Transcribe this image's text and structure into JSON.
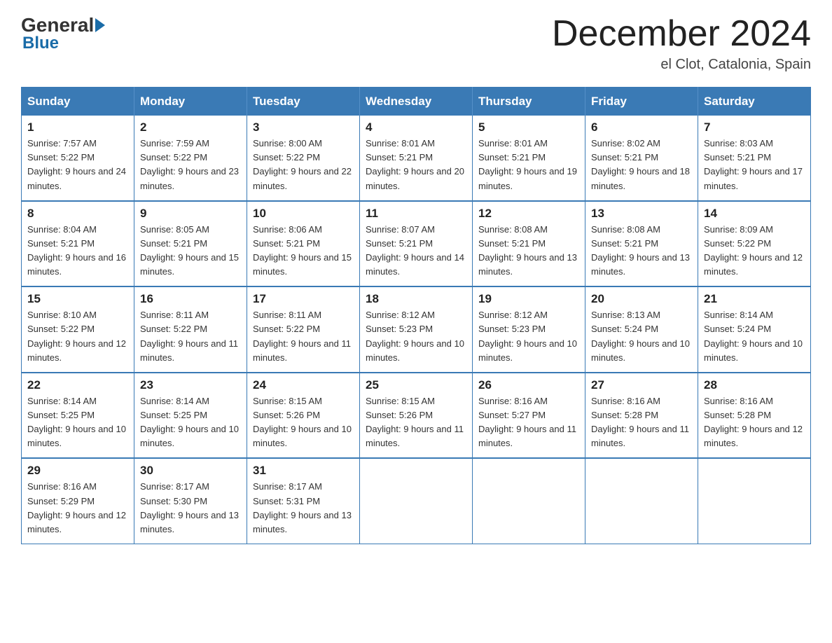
{
  "logo": {
    "general": "General",
    "blue": "Blue"
  },
  "header": {
    "month_title": "December 2024",
    "location": "el Clot, Catalonia, Spain"
  },
  "days_of_week": [
    "Sunday",
    "Monday",
    "Tuesday",
    "Wednesday",
    "Thursday",
    "Friday",
    "Saturday"
  ],
  "weeks": [
    [
      {
        "day": "1",
        "sunrise": "7:57 AM",
        "sunset": "5:22 PM",
        "daylight": "9 hours and 24 minutes."
      },
      {
        "day": "2",
        "sunrise": "7:59 AM",
        "sunset": "5:22 PM",
        "daylight": "9 hours and 23 minutes."
      },
      {
        "day": "3",
        "sunrise": "8:00 AM",
        "sunset": "5:22 PM",
        "daylight": "9 hours and 22 minutes."
      },
      {
        "day": "4",
        "sunrise": "8:01 AM",
        "sunset": "5:21 PM",
        "daylight": "9 hours and 20 minutes."
      },
      {
        "day": "5",
        "sunrise": "8:01 AM",
        "sunset": "5:21 PM",
        "daylight": "9 hours and 19 minutes."
      },
      {
        "day": "6",
        "sunrise": "8:02 AM",
        "sunset": "5:21 PM",
        "daylight": "9 hours and 18 minutes."
      },
      {
        "day": "7",
        "sunrise": "8:03 AM",
        "sunset": "5:21 PM",
        "daylight": "9 hours and 17 minutes."
      }
    ],
    [
      {
        "day": "8",
        "sunrise": "8:04 AM",
        "sunset": "5:21 PM",
        "daylight": "9 hours and 16 minutes."
      },
      {
        "day": "9",
        "sunrise": "8:05 AM",
        "sunset": "5:21 PM",
        "daylight": "9 hours and 15 minutes."
      },
      {
        "day": "10",
        "sunrise": "8:06 AM",
        "sunset": "5:21 PM",
        "daylight": "9 hours and 15 minutes."
      },
      {
        "day": "11",
        "sunrise": "8:07 AM",
        "sunset": "5:21 PM",
        "daylight": "9 hours and 14 minutes."
      },
      {
        "day": "12",
        "sunrise": "8:08 AM",
        "sunset": "5:21 PM",
        "daylight": "9 hours and 13 minutes."
      },
      {
        "day": "13",
        "sunrise": "8:08 AM",
        "sunset": "5:21 PM",
        "daylight": "9 hours and 13 minutes."
      },
      {
        "day": "14",
        "sunrise": "8:09 AM",
        "sunset": "5:22 PM",
        "daylight": "9 hours and 12 minutes."
      }
    ],
    [
      {
        "day": "15",
        "sunrise": "8:10 AM",
        "sunset": "5:22 PM",
        "daylight": "9 hours and 12 minutes."
      },
      {
        "day": "16",
        "sunrise": "8:11 AM",
        "sunset": "5:22 PM",
        "daylight": "9 hours and 11 minutes."
      },
      {
        "day": "17",
        "sunrise": "8:11 AM",
        "sunset": "5:22 PM",
        "daylight": "9 hours and 11 minutes."
      },
      {
        "day": "18",
        "sunrise": "8:12 AM",
        "sunset": "5:23 PM",
        "daylight": "9 hours and 10 minutes."
      },
      {
        "day": "19",
        "sunrise": "8:12 AM",
        "sunset": "5:23 PM",
        "daylight": "9 hours and 10 minutes."
      },
      {
        "day": "20",
        "sunrise": "8:13 AM",
        "sunset": "5:24 PM",
        "daylight": "9 hours and 10 minutes."
      },
      {
        "day": "21",
        "sunrise": "8:14 AM",
        "sunset": "5:24 PM",
        "daylight": "9 hours and 10 minutes."
      }
    ],
    [
      {
        "day": "22",
        "sunrise": "8:14 AM",
        "sunset": "5:25 PM",
        "daylight": "9 hours and 10 minutes."
      },
      {
        "day": "23",
        "sunrise": "8:14 AM",
        "sunset": "5:25 PM",
        "daylight": "9 hours and 10 minutes."
      },
      {
        "day": "24",
        "sunrise": "8:15 AM",
        "sunset": "5:26 PM",
        "daylight": "9 hours and 10 minutes."
      },
      {
        "day": "25",
        "sunrise": "8:15 AM",
        "sunset": "5:26 PM",
        "daylight": "9 hours and 11 minutes."
      },
      {
        "day": "26",
        "sunrise": "8:16 AM",
        "sunset": "5:27 PM",
        "daylight": "9 hours and 11 minutes."
      },
      {
        "day": "27",
        "sunrise": "8:16 AM",
        "sunset": "5:28 PM",
        "daylight": "9 hours and 11 minutes."
      },
      {
        "day": "28",
        "sunrise": "8:16 AM",
        "sunset": "5:28 PM",
        "daylight": "9 hours and 12 minutes."
      }
    ],
    [
      {
        "day": "29",
        "sunrise": "8:16 AM",
        "sunset": "5:29 PM",
        "daylight": "9 hours and 12 minutes."
      },
      {
        "day": "30",
        "sunrise": "8:17 AM",
        "sunset": "5:30 PM",
        "daylight": "9 hours and 13 minutes."
      },
      {
        "day": "31",
        "sunrise": "8:17 AM",
        "sunset": "5:31 PM",
        "daylight": "9 hours and 13 minutes."
      },
      null,
      null,
      null,
      null
    ]
  ]
}
